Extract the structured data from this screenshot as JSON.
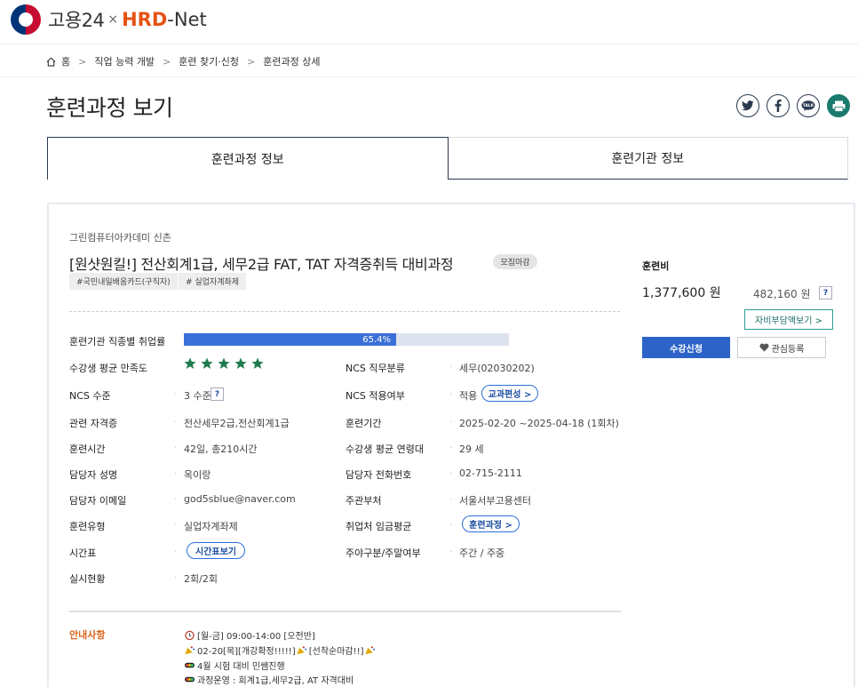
{
  "header": {
    "logo_brand": "고용24",
    "logo_x": "×",
    "logo_hrd": "HRD",
    "logo_net": "-Net"
  },
  "breadcrumb": {
    "home": "홈",
    "items": [
      "직업 능력 개발",
      "훈련 찾기·신청",
      "훈련과정 상세"
    ]
  },
  "page_title": "훈련과정 보기",
  "share_icons": [
    "twitter-icon",
    "facebook-icon",
    "kakaotalk-icon",
    "print-icon"
  ],
  "tabs": [
    {
      "label": "훈련과정 정보",
      "active": true
    },
    {
      "label": "훈련기관 정보",
      "active": false
    }
  ],
  "course": {
    "institution": "그린컴퓨터아카데미 신촌",
    "title": "[원샷원킬!] 전산회계1급, 세무2급 FAT, TAT 자격증취득 대비과정",
    "status": "모집마감",
    "tags": [
      "#국민내일배움카드(구직자)",
      "# 실업자계좌제"
    ]
  },
  "details": {
    "employment_rate_label": "훈련기관 직종별 취업률",
    "employment_rate_text": "65.4%",
    "employment_rate": 0.654,
    "satisfaction_label": "수강생 평균 만족도",
    "satisfaction_stars": 5,
    "ncs_class_label": "NCS 직무분류",
    "ncs_class_value": "세무(02030202)",
    "ncs_level_label": "NCS 수준",
    "ncs_level_value": "3 수준",
    "ncs_apply_label": "NCS 적용여부",
    "ncs_apply_value": "적용",
    "curriculum_btn": "교과편성 >",
    "cert_label": "관련 자격증",
    "cert_value": "전산세무2급,전산회계1급",
    "period_label": "훈련기간",
    "period_value": "2025-02-20 ~2025-04-18 (1회차)",
    "hours_label": "훈련시간",
    "hours_value": "42일, 총210시간",
    "age_label": "수강생 평균 연령대",
    "age_value": "29 세",
    "manager_label": "담당자 성명",
    "manager_value": "옥이랑",
    "phone_label": "담당자 전화번호",
    "phone_value": "02-715-2111",
    "email_label": "담당자 이메일",
    "email_value": "god5sblue@naver.com",
    "dept_label": "주관부처",
    "dept_value": "서울서부고용센터",
    "type_label": "훈련유형",
    "type_value": "실업자계좌제",
    "wage_label": "취업처 임금평균",
    "wage_btn": "훈련과정 >",
    "timetable_label": "시간표",
    "timetable_btn": "시간표보기",
    "daynight_label": "주야구분/주말여부",
    "daynight_value": "주간 / 주중",
    "status_label": "실시현황",
    "status_value": "2회/2회"
  },
  "notice": {
    "label": "안내사항",
    "lines": [
      {
        "icon": "alarm-clock-icon",
        "text": "[월-금] 09:00-14:00 [오전반]"
      },
      {
        "icon": "party-popper-icon",
        "text": "02-20[목][개강확정!!!!!]",
        "icon2": "party-popper-icon",
        "text2": "[선착순마감!!]",
        "icon3": "party-popper-icon"
      },
      {
        "icon": "traffic-light-icon",
        "text": "4월 시험 대비 민쌤진행"
      },
      {
        "icon": "traffic-light-icon",
        "text": "과정운영 : 회계1급,세무2급, AT 자격대비"
      }
    ]
  },
  "fee": {
    "label": "훈련비",
    "total": "1,377,600 원",
    "self_pay": "482,160 원",
    "self_pay_btn": "자비부담액보기 >",
    "help": "?",
    "apply_btn": "수강신청",
    "wish_btn": "관심등록"
  },
  "colors": {
    "accent_blue": "#2d63c8",
    "star_green": "#1f7a4c",
    "notice_orange": "#d9621a",
    "hrd_orange": "#e55314"
  }
}
